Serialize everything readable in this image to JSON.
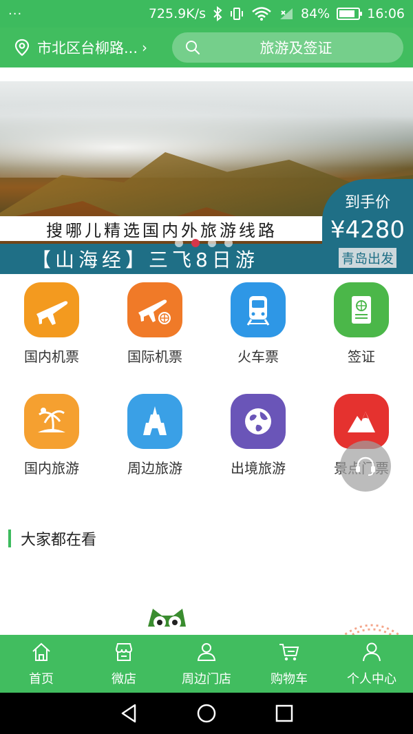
{
  "status_bar": {
    "dots": "···",
    "speed": "725.9K/s",
    "battery_percent": "84%",
    "battery_level": 0.84,
    "time": "16:06"
  },
  "header": {
    "location": "市北区台柳路...",
    "search_placeholder": "旅游及签证"
  },
  "banner": {
    "headline": "搜哪儿精选国内外旅游线路",
    "subtitle": "【山海经】三飞8日游",
    "price_label": "到手价",
    "price_value": "¥4280",
    "depart_label": "青岛出发",
    "active_slide": 2,
    "slide_count": 4
  },
  "grid": {
    "items": [
      {
        "label": "国内机票",
        "color": "#f39a1f",
        "icon": "airplane-icon"
      },
      {
        "label": "国际机票",
        "color": "#f07a28",
        "icon": "international-flight-icon"
      },
      {
        "label": "火车票",
        "color": "#2e97e6",
        "icon": "train-icon"
      },
      {
        "label": "签证",
        "color": "#4bb749",
        "icon": "passport-icon"
      },
      {
        "label": "国内旅游",
        "color": "#f5a030",
        "icon": "palm-tree-icon"
      },
      {
        "label": "周边旅游",
        "color": "#3aa0e6",
        "icon": "tower-icon"
      },
      {
        "label": "出境旅游",
        "color": "#6a55b8",
        "icon": "globe-icon"
      },
      {
        "label": "景点门票",
        "color": "#e5322f",
        "icon": "mountain-icon"
      }
    ]
  },
  "section": {
    "title": "大家都在看"
  },
  "bottom_nav": {
    "items": [
      {
        "label": "首页",
        "icon": "home-icon"
      },
      {
        "label": "微店",
        "icon": "shop-icon"
      },
      {
        "label": "周边门店",
        "icon": "nearby-store-icon"
      },
      {
        "label": "购物车",
        "icon": "cart-icon"
      },
      {
        "label": "个人中心",
        "icon": "user-icon"
      }
    ]
  }
}
